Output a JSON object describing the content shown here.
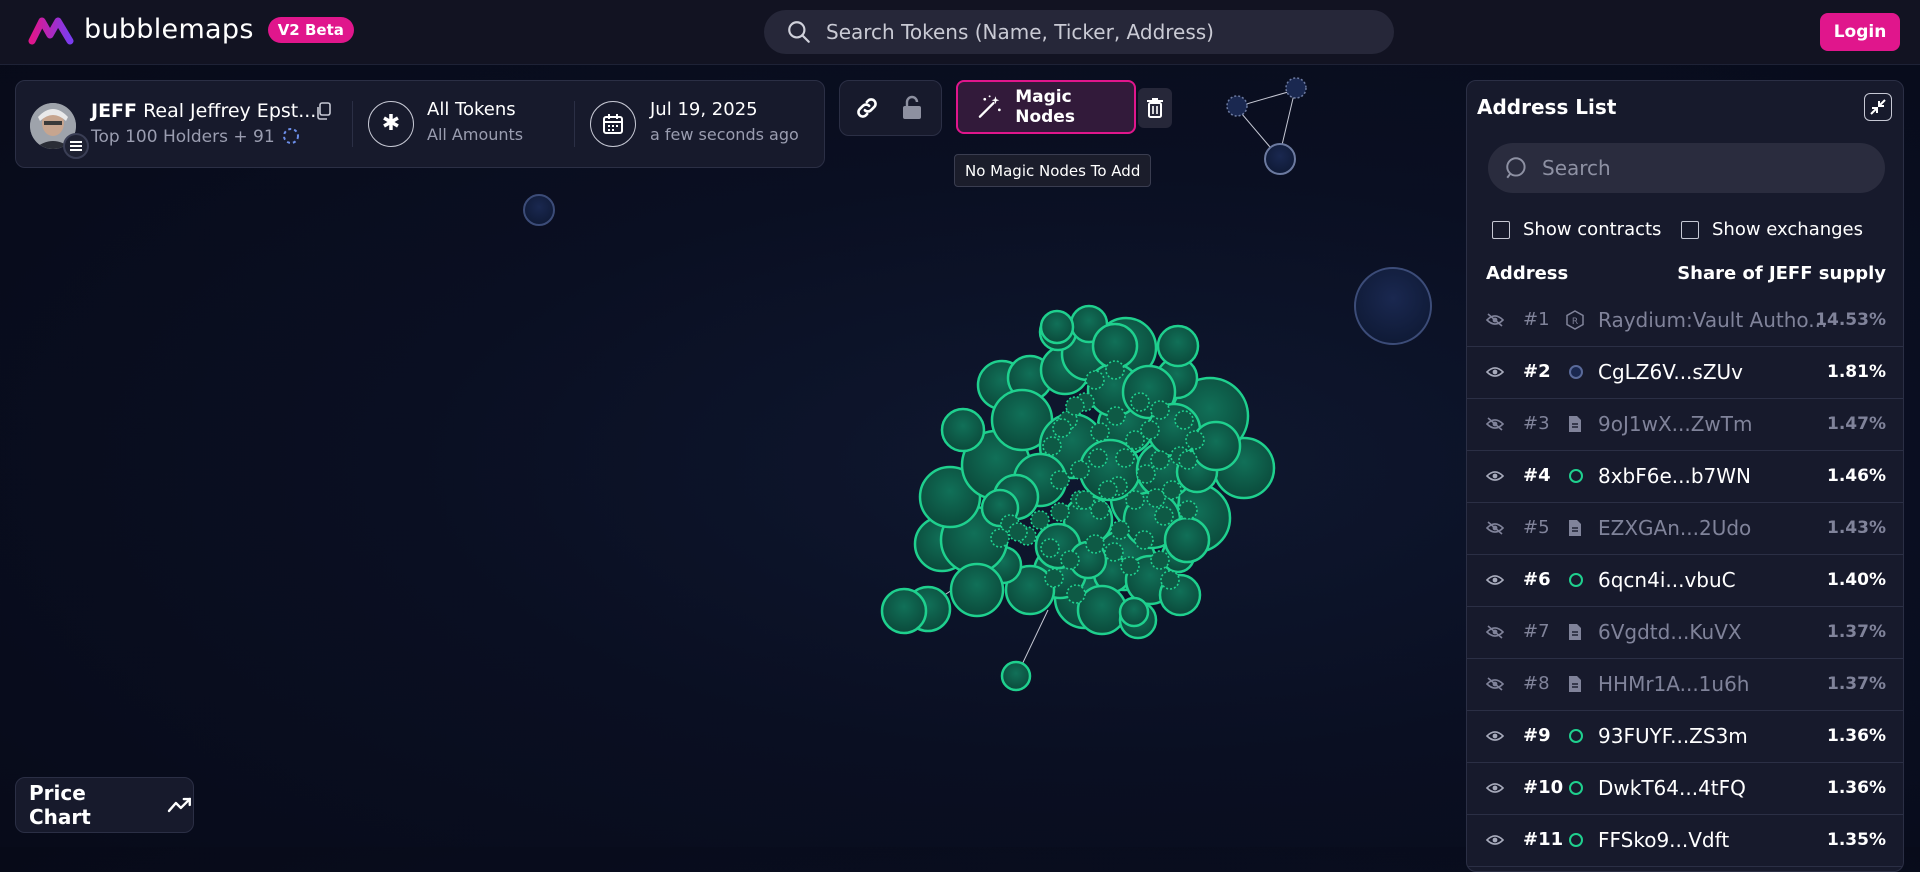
{
  "header": {
    "logo_text": "bubblemaps",
    "beta_label": "V2 Beta",
    "search_placeholder": "Search Tokens (Name, Ticker, Address)",
    "login_label": "Login"
  },
  "token_panel": {
    "ticker": "JEFF",
    "name": "Real Jeffrey Epst...",
    "holders_text": "Top 100 Holders + 91",
    "filter_title": "All Tokens",
    "filter_sub": "All Amounts",
    "date": "Jul 19, 2025",
    "date_sub": "a few seconds ago"
  },
  "toolbar": {
    "magic_nodes_label": "Magic Nodes",
    "tooltip": "No Magic Nodes To Add"
  },
  "price_chart_label": "Price Chart",
  "address_list": {
    "title": "Address List",
    "search_placeholder": "Search",
    "show_contracts": "Show contracts",
    "show_exchanges": "Show exchanges",
    "col_address": "Address",
    "col_share": "Share of JEFF supply",
    "rows": [
      {
        "rank": "#1",
        "address": "Raydium:Vault Autho...",
        "share": "14.53%",
        "hidden": true,
        "icon": "raydium-icon"
      },
      {
        "rank": "#2",
        "address": "CgLZ6V...sZUv",
        "share": "1.81%",
        "hidden": false,
        "icon": "blue-dot"
      },
      {
        "rank": "#3",
        "address": "9oJ1wX...ZwTm",
        "share": "1.47%",
        "hidden": true,
        "icon": "file-icon"
      },
      {
        "rank": "#4",
        "address": "8xbF6e...b7WN",
        "share": "1.46%",
        "hidden": false,
        "icon": "green-dot"
      },
      {
        "rank": "#5",
        "address": "EZXGAn...2Udo",
        "share": "1.43%",
        "hidden": true,
        "icon": "file-icon"
      },
      {
        "rank": "#6",
        "address": "6qcn4i...vbuC",
        "share": "1.40%",
        "hidden": false,
        "icon": "green-dot"
      },
      {
        "rank": "#7",
        "address": "6Vgdtd...KuVX",
        "share": "1.37%",
        "hidden": true,
        "icon": "file-icon"
      },
      {
        "rank": "#8",
        "address": "HHMr1A...1u6h",
        "share": "1.37%",
        "hidden": true,
        "icon": "file-icon"
      },
      {
        "rank": "#9",
        "address": "93FUYF...ZS3m",
        "share": "1.36%",
        "hidden": false,
        "icon": "green-dot"
      },
      {
        "rank": "#10",
        "address": "DwkT64...4tFQ",
        "share": "1.36%",
        "hidden": false,
        "icon": "green-dot"
      },
      {
        "rank": "#11",
        "address": "FFSko9...Vdft",
        "share": "1.35%",
        "hidden": false,
        "icon": "green-dot"
      }
    ]
  },
  "colors": {
    "accent": "#e0168c",
    "bubble_green": "#1fd08e",
    "bubble_fill": "#0e5a45",
    "bubble_blue": "#2a3b64"
  }
}
